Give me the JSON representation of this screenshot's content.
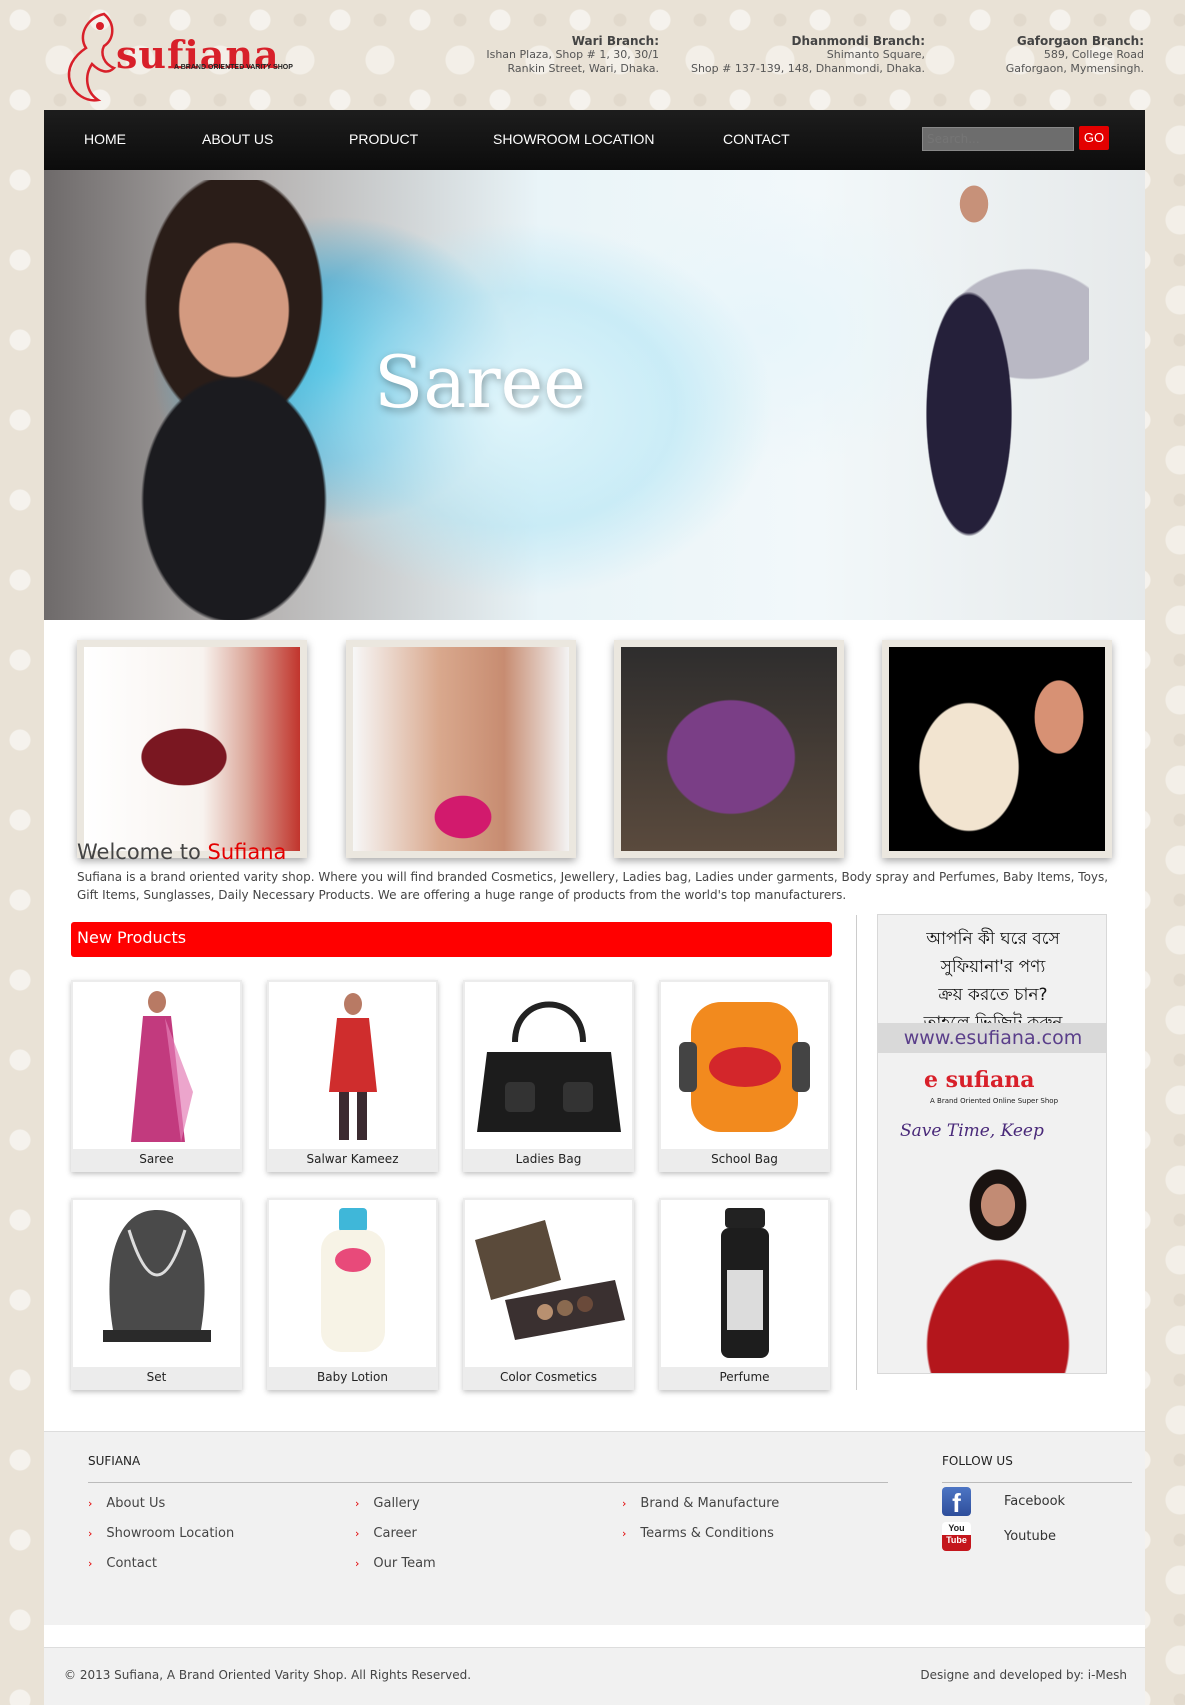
{
  "header": {
    "logo_text": "sufiana",
    "logo_tagline": "A BRAND ORIENTED VARITY SHOP",
    "branches": [
      {
        "title": "Wari Branch:",
        "line1": "Ishan Plaza, Shop # 1, 30, 30/1",
        "line2": "Rankin Street, Wari, Dhaka."
      },
      {
        "title": "Dhanmondi Branch:",
        "line1": "Shimanto Square,",
        "line2": "Shop # 137-139, 148, Dhanmondi, Dhaka."
      },
      {
        "title": "Gaforgaon Branch:",
        "line1": "589, College Road",
        "line2": "Gaforgaon, Mymensingh."
      }
    ]
  },
  "nav": {
    "items": [
      "HOME",
      "ABOUT US",
      "PRODUCT",
      "SHOWROOM LOCATION",
      "CONTACT"
    ],
    "search_placeholder": "Search...",
    "go_label": "GO"
  },
  "hero": {
    "title": "Saree"
  },
  "thumbnails": [
    "handbag-photo",
    "necklace-photo",
    "gift-box-photo",
    "teddy-bear-photo"
  ],
  "welcome": {
    "prefix": "Welcome to",
    "brand": "Sufiana",
    "text": "Sufiana is a brand oriented varity shop. Where you will find branded Cosmetics, Jewellery, Ladies bag, Ladies under garments, Body spray and Perfumes, Baby Items, Toys, Gift Items, Sunglasses, Daily Necessary Products. We are offering a huge range of products from the world's top manufacturers."
  },
  "new_products": {
    "heading": "New Products",
    "items": [
      "Saree",
      "Salwar Kameez",
      "Ladies Bag",
      "School Bag",
      "Set",
      "Baby Lotion",
      "Color Cosmetics",
      "Perfume"
    ]
  },
  "ad": {
    "bangla_lines": [
      "আপনি কী ঘরে বসে",
      "সুফিয়ানা'র পণ্য",
      "ক্রয় করতে চান?",
      "তাহলে ভিজিট করুন"
    ],
    "url": "www.esufiana.com",
    "logo": "e sufiana",
    "tagline": "A Brand Oriented Online Super Shop",
    "slogan": "Save Time, Keep"
  },
  "footer": {
    "title": "SUFIANA",
    "links": [
      "About Us",
      "Showroom Location",
      "Contact",
      "Gallery",
      "Career",
      "Our Team",
      "Brand & Manufacture",
      "Tearms & Conditions"
    ],
    "follow_title": "FOLLOW US",
    "social": [
      "Facebook",
      "Youtube"
    ]
  },
  "bottom": {
    "copyright": "© 2013 Sufiana, A Brand Oriented Varity Shop. All Rights Reserved.",
    "credit": "Designe and developed by: i-Mesh"
  },
  "colors": {
    "accent": "#e30000",
    "nav_bg": "#111111",
    "brand": "#d8202a"
  }
}
